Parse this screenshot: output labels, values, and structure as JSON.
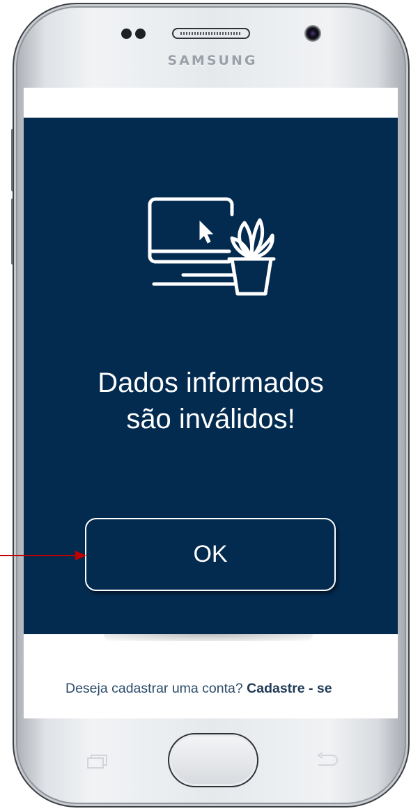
{
  "device": {
    "brand": "SAMSUNG"
  },
  "dialog": {
    "illustration_icon": "computer-with-plant-icon",
    "message_line1": "Dados informados",
    "message_line2": "são inválidos!",
    "ok_label": "OK",
    "background_color": "#032a4f"
  },
  "signup": {
    "prompt": "Deseja cadastrar uma conta?",
    "link": "Cadastre - se"
  },
  "annotation": {
    "arrow_icon": "red-arrow-pointing-to-ok",
    "color": "#c00000"
  }
}
